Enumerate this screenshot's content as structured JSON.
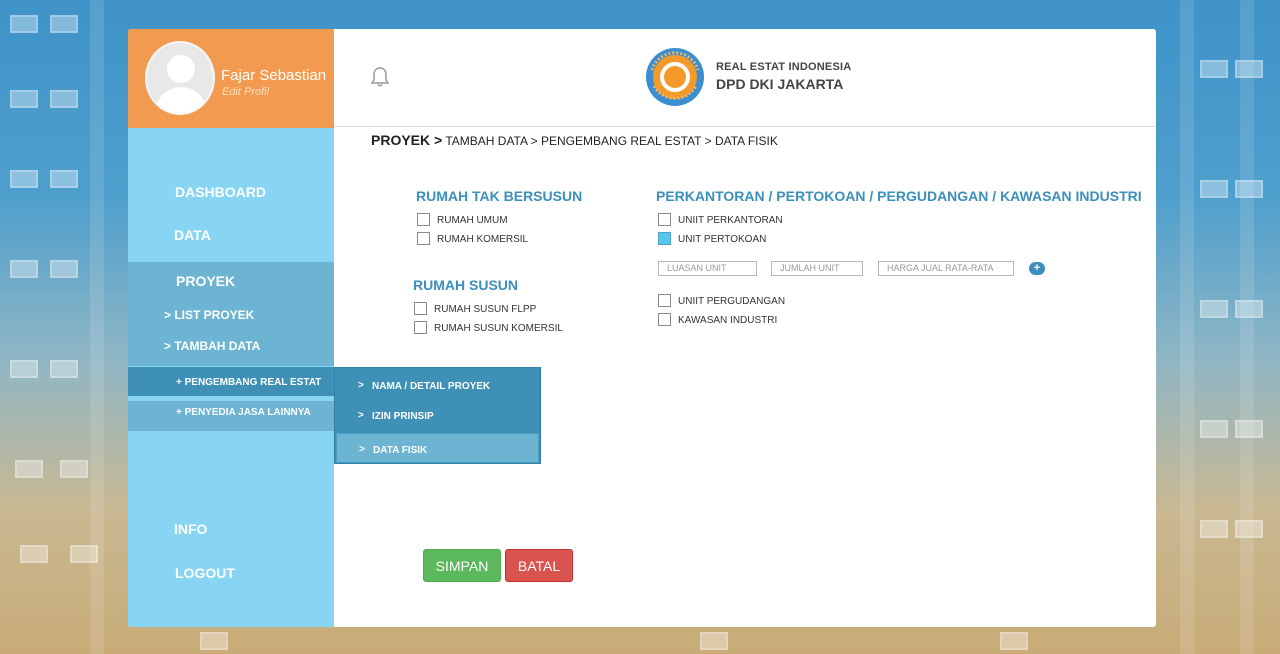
{
  "profile": {
    "name": "Fajar Sebastian",
    "edit_label": "Edit Profil"
  },
  "header": {
    "org_line1": "REAL ESTAT INDONESIA",
    "org_line2": "DPD DKI JAKARTA",
    "logo_ring_text": "REALESTAT INDONESIA"
  },
  "sidebar": {
    "dashboard": "DASHBOARD",
    "data": "DATA",
    "proyek": "PROYEK",
    "list_proyek": "> LIST PROYEK",
    "tambah_data": "> TAMBAH DATA",
    "pengembang": "+ PENGEMBANG REAL ESTAT",
    "penyedia": "+ PENYEDIA JASA LAINNYA",
    "info": "INFO",
    "logout": "LOGOUT"
  },
  "flyout": {
    "items": [
      {
        "marker": ">",
        "label": "NAMA / DETAIL PROYEK"
      },
      {
        "marker": ">",
        "label": "IZIN PRINSIP"
      },
      {
        "marker": ">",
        "label": "DATA FISIK"
      }
    ]
  },
  "breadcrumb": {
    "root": "PROYEK >",
    "rest": "TAMBAH DATA > PENGEMBANG REAL ESTAT > DATA FISIK"
  },
  "sections": {
    "tak_bersusun": {
      "title": "RUMAH TAK BERSUSUN",
      "options": [
        "RUMAH UMUM",
        "RUMAH KOMERSIL"
      ]
    },
    "susun": {
      "title": "RUMAH SUSUN",
      "options": [
        "RUMAH SUSUN FLPP",
        "RUMAH SUSUN KOMERSIL"
      ]
    },
    "perkantoran": {
      "title": "PERKANTORAN / PERTOKOAN / PERGUDANGAN / KAWASAN INDUSTRI",
      "options_top": [
        "UNIIT PERKANTORAN",
        "UNIT PERTOKOAN"
      ],
      "options_bottom": [
        "UNIIT PERGUDANGAN",
        "KAWASAN INDUSTRI"
      ],
      "checked": "UNIT PERTOKOAN"
    }
  },
  "fields": {
    "luasan": "LUASAN UNIT",
    "jumlah": "JUMLAH UNIT",
    "harga": "HARGA JUAL RATA-RATA",
    "add": "+"
  },
  "buttons": {
    "save": "SIMPAN",
    "cancel": "BATAL"
  },
  "colors": {
    "sidebar": "#87d5f2",
    "profile": "#f39a51",
    "accent": "#3b8fbd",
    "save": "#5cb85c",
    "cancel": "#d9534f"
  }
}
